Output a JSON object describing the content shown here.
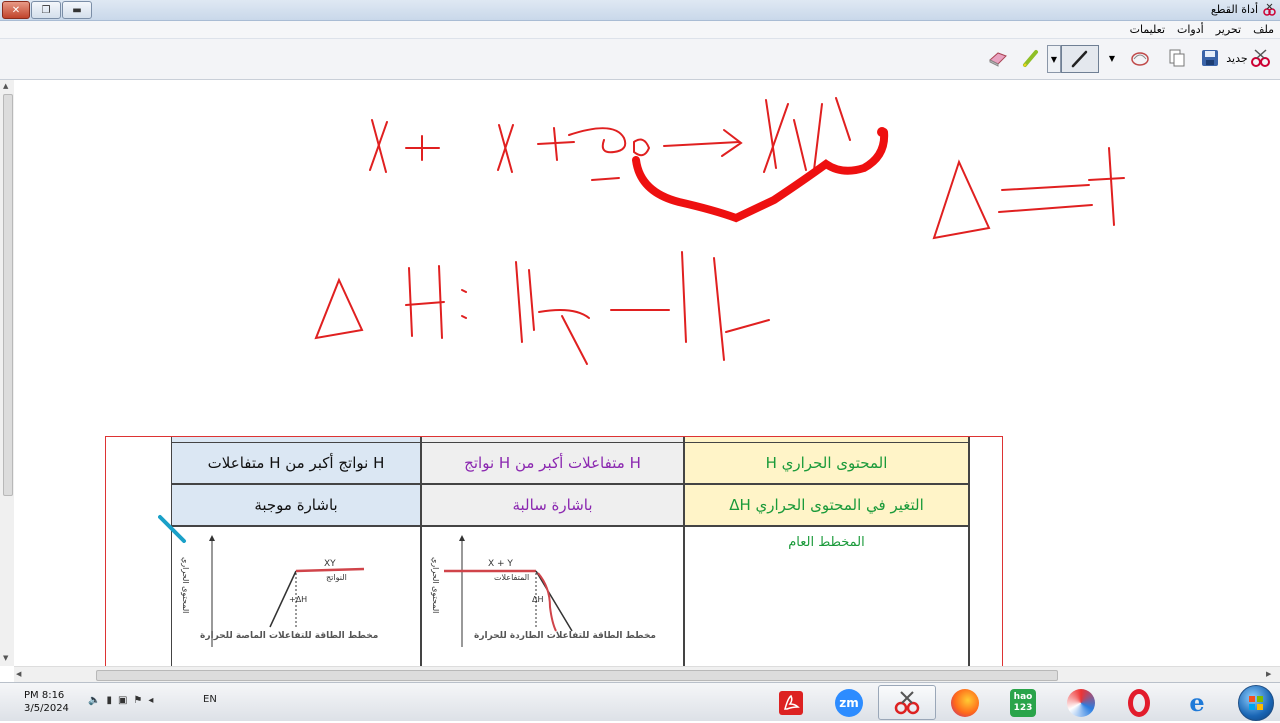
{
  "window": {
    "title": "أداة القطع"
  },
  "menu": {
    "items": [
      "ملف",
      "تحرير",
      "أدوات",
      "تعليمات"
    ]
  },
  "toolbar": {
    "new_label": "جديد"
  },
  "ink_text": {
    "line1": "X + X  → XY",
    "delta": "Δ = +",
    "equation": "ΔH = Hp − Hr"
  },
  "table": {
    "top_partial_left": "",
    "row_h": {
      "label": "المحتوى الحراري H",
      "exo": "H متفاعلات أكبر من H نواتج",
      "endo": "H نواتج أكبر من H متفاعلات"
    },
    "row_dh": {
      "label": "التغير في المحتوى الحراري ΔH",
      "exo": "باشارة سالبة",
      "endo": "باشارة موجبة"
    },
    "row_graph": {
      "label": "المخطط العام",
      "exo_caption": "مخطط الطاقة للتفاعلات الطاردة للحرارة",
      "endo_caption": "مخطط الطاقة للتفاعلات الماصة للحرارة",
      "exo_top_label": "X + Y",
      "exo_sub_label": "المتفاعلات",
      "endo_top_label": "XY",
      "endo_sub_label": "النواتج",
      "y_axis": "المحتوى الحراري",
      "dh_label": "ΔH",
      "dh_plus": "ΔH+"
    },
    "colors": {
      "green": "#1a9a3a",
      "purple": "#8b28b0",
      "blue_bg": "#dbe7f3",
      "yellow_bg": "#fff4c8"
    }
  },
  "taskbar": {
    "time": "PM 8:16",
    "date": "3/5/2024",
    "lang": "EN",
    "apps": [
      "pdf-icon",
      "zoom-icon",
      "snipping-tool-icon",
      "firefox-icon",
      "hao123-icon",
      "app-swirl-icon",
      "opera-icon",
      "ie-icon"
    ],
    "zoom_label": "zm",
    "hao_label": "hao\n123"
  }
}
